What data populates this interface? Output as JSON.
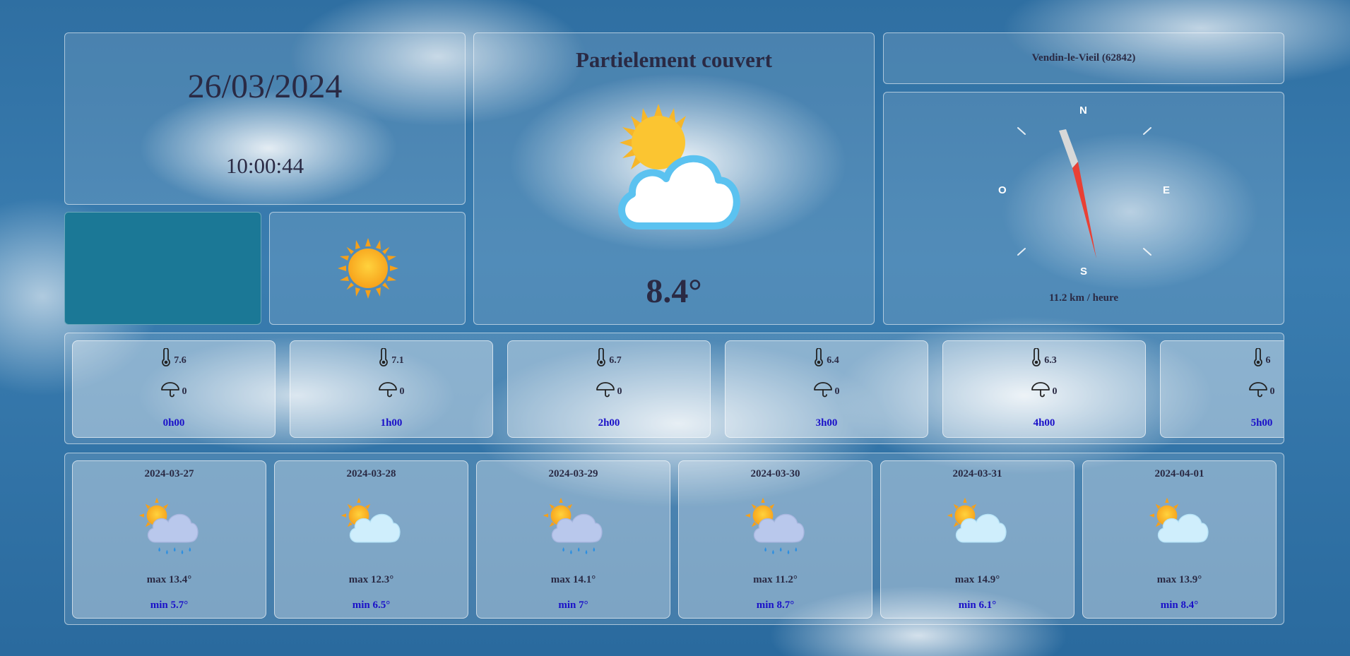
{
  "datetime": {
    "date": "26/03/2024",
    "time": "10:00:44"
  },
  "current": {
    "condition": "Partielement couvert",
    "temperature": "8.4°",
    "icon": "sun-cloud-icon"
  },
  "location": {
    "name": "Vendin-le-Vieil (62842)"
  },
  "wind": {
    "n": "N",
    "e": "E",
    "s": "S",
    "o": "O",
    "speed": "11.2 km / heure"
  },
  "colors": {
    "teal_panel": "#1b7896",
    "min_temp": "#1a10c8"
  },
  "hourly": [
    {
      "temp": "7.6",
      "rain": "0",
      "hour": "0h00"
    },
    {
      "temp": "7.1",
      "rain": "0",
      "hour": "1h00"
    },
    {
      "temp": "6.7",
      "rain": "0",
      "hour": "2h00"
    },
    {
      "temp": "6.4",
      "rain": "0",
      "hour": "3h00"
    },
    {
      "temp": "6.3",
      "rain": "0",
      "hour": "4h00"
    },
    {
      "temp": "6",
      "rain": "0",
      "hour": "5h00"
    }
  ],
  "daily": [
    {
      "date": "2024-03-27",
      "icon": "rain-cloud-icon",
      "max": "max 13.4°",
      "min": "min 5.7°"
    },
    {
      "date": "2024-03-28",
      "icon": "sun-cloud-icon",
      "max": "max 12.3°",
      "min": "min 6.5°"
    },
    {
      "date": "2024-03-29",
      "icon": "rain-cloud-icon",
      "max": "max 14.1°",
      "min": "min 7°"
    },
    {
      "date": "2024-03-30",
      "icon": "rain-cloud-icon",
      "max": "max 11.2°",
      "min": "min 8.7°"
    },
    {
      "date": "2024-03-31",
      "icon": "sun-cloud-icon",
      "max": "max 14.9°",
      "min": "min 6.1°"
    },
    {
      "date": "2024-04-01",
      "icon": "sun-cloud-icon",
      "max": "max 13.9°",
      "min": "min 8.4°"
    }
  ]
}
